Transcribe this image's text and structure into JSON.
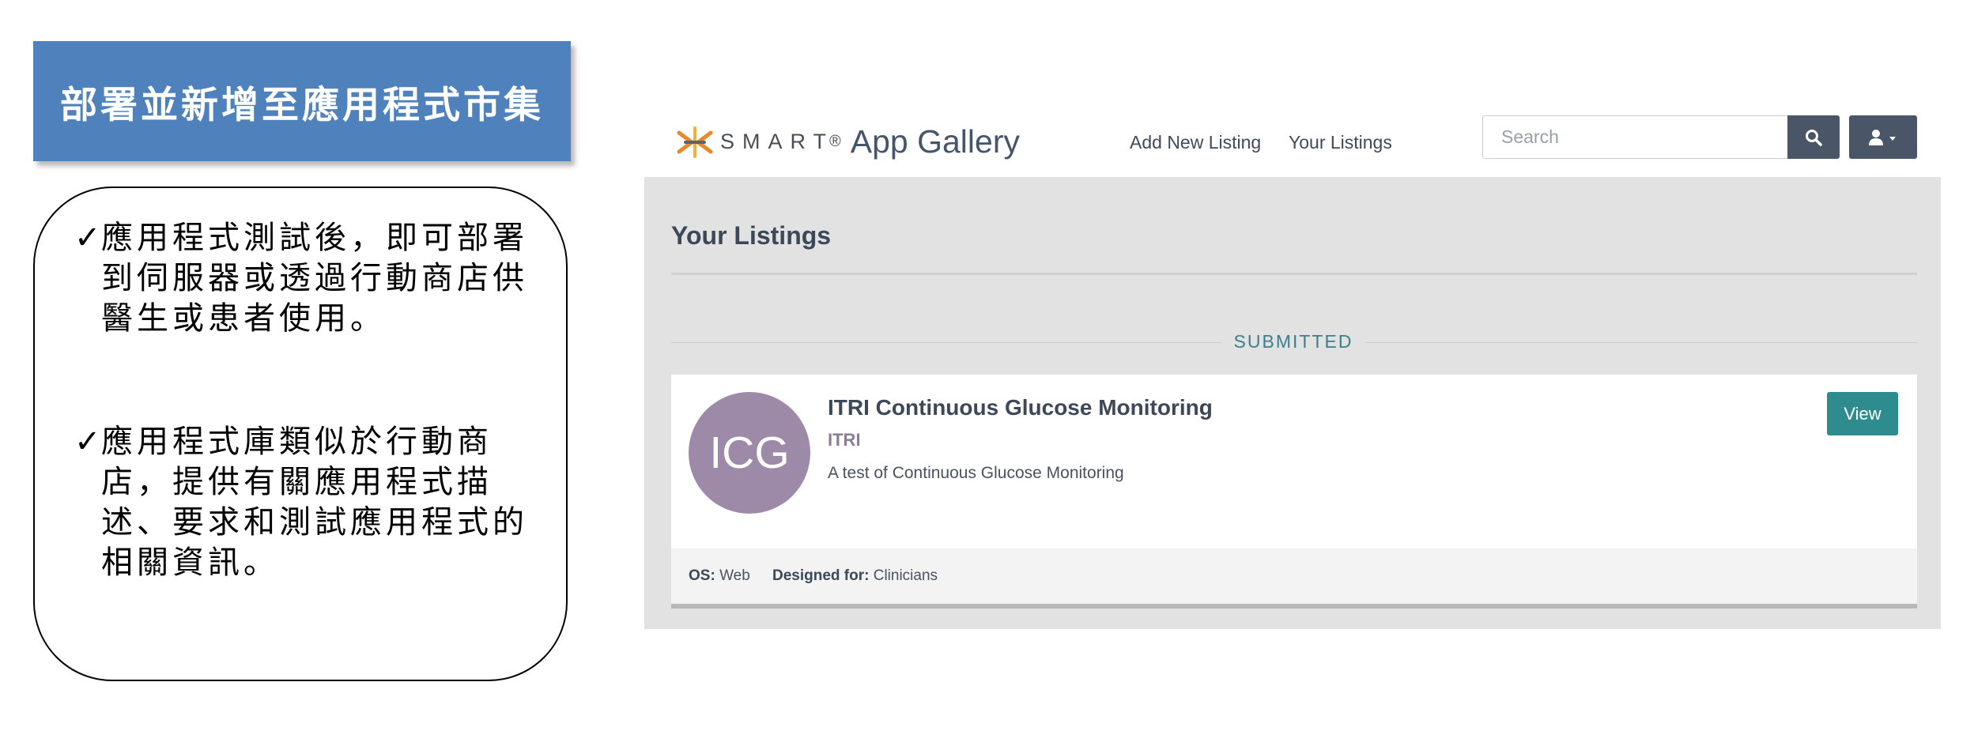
{
  "slide": {
    "title": "部署並新增至應用程式市集",
    "check_glyph": "✓",
    "bullets": [
      "應用程式測試後，即可部署到伺服器或透過行動商店供醫生或患者使用。",
      "應用程式庫類似於行動商店，提供有關應用程式描述、要求和測試應用程式的相關資訊。"
    ]
  },
  "gallery": {
    "brand": {
      "smart": "SMART",
      "reg": "®",
      "app_gallery": "App Gallery"
    },
    "nav": {
      "add_new_listing": "Add New Listing",
      "your_listings": "Your Listings"
    },
    "search": {
      "placeholder": "Search",
      "button_icon": "search-icon",
      "user_icon": "user-icon"
    },
    "page_title": "Your Listings",
    "section_label": "SUBMITTED",
    "listing": {
      "initials": "ICG",
      "name": "ITRI Continuous Glucose Monitoring",
      "org": "ITRI",
      "description": "A test of Continuous Glucose Monitoring",
      "view_label": "View",
      "os_label": "OS:",
      "os_value": "Web",
      "designed_for_label": "Designed for:",
      "designed_for_value": "Clinicians"
    },
    "colors": {
      "title_bar": "#4f81bd",
      "accent_teal": "#2e8b8e",
      "avatar": "#9d8aa8",
      "button_dark": "#4a5568"
    }
  }
}
